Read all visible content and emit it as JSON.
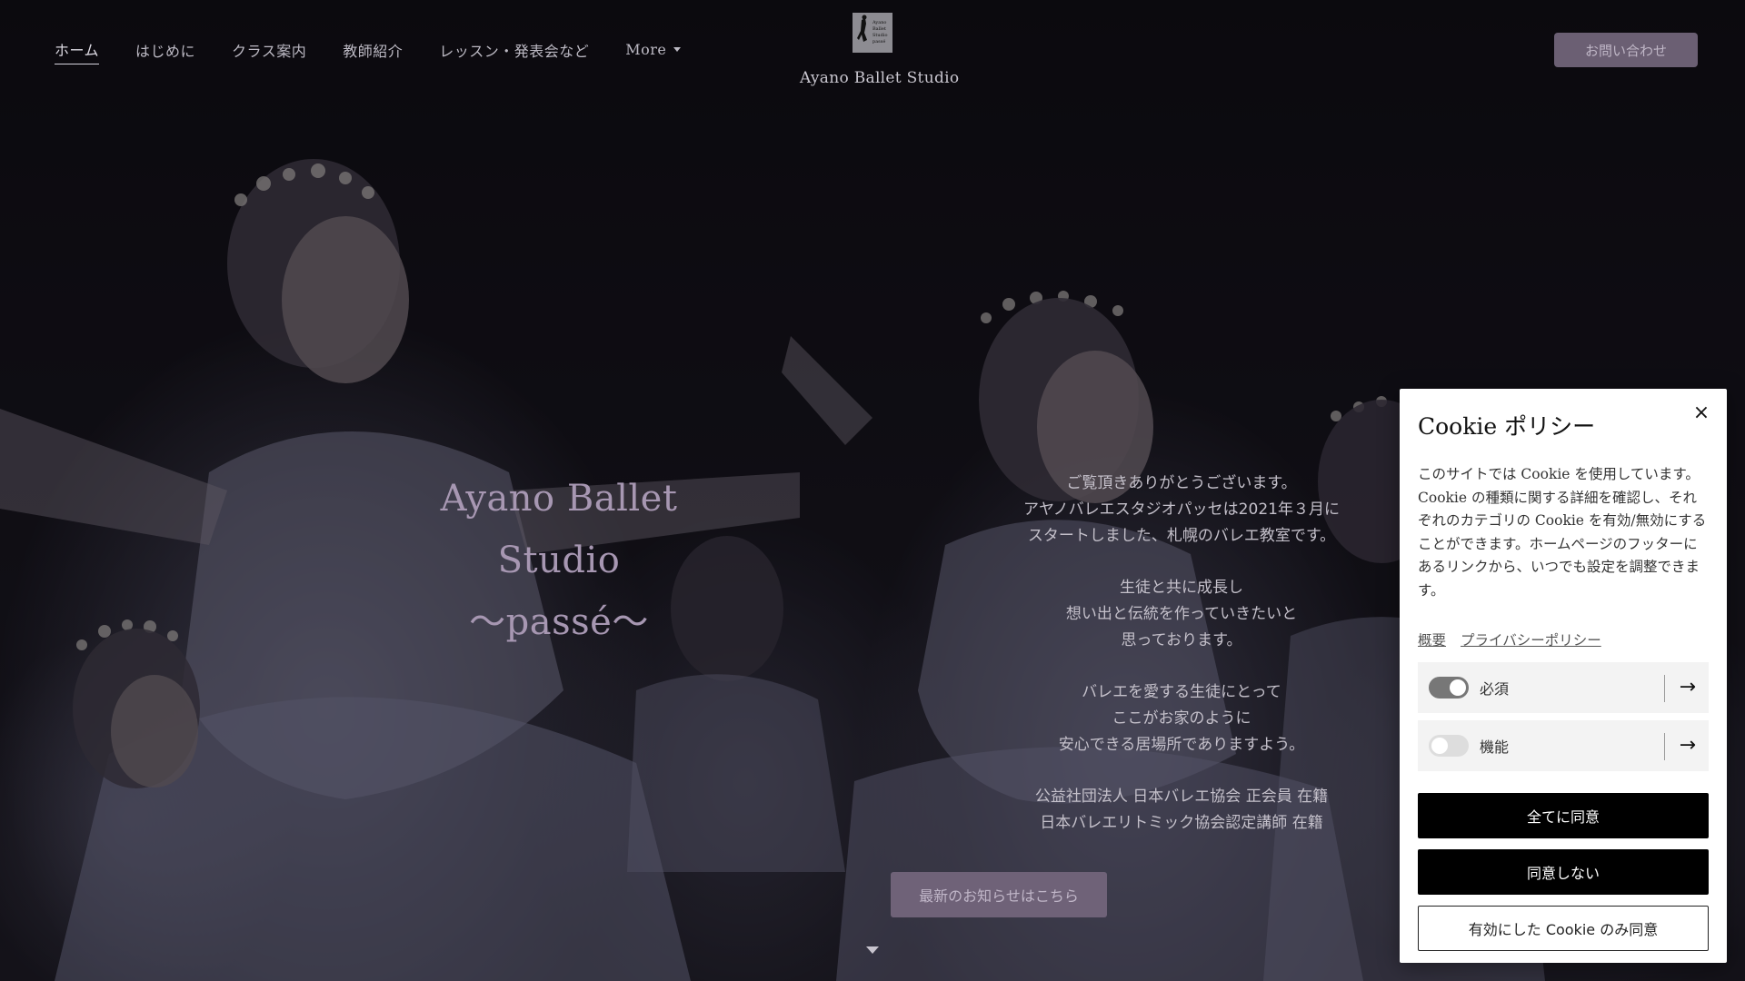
{
  "header": {
    "nav": [
      {
        "label": "ホーム",
        "active": true
      },
      {
        "label": "はじめに"
      },
      {
        "label": "クラス案内"
      },
      {
        "label": "教師紹介"
      },
      {
        "label": "レッスン・発表会など"
      },
      {
        "label": "More"
      }
    ],
    "logo_lines": [
      "Ayano",
      "Ballet",
      "Studio",
      "passé"
    ],
    "site_name": "Ayano Ballet Studio",
    "contact_label": "お問い合わせ"
  },
  "hero": {
    "title_line1": "Ayano Ballet Studio",
    "title_line2": "〜passé〜",
    "paragraphs": [
      [
        "ご覧頂きありがとうございます。",
        "アヤノバレエスタジオパッセは2021年３月に",
        "スタートしました、札幌のバレエ教室です。"
      ],
      [
        "生徒と共に成長し",
        "想い出と伝統を作っていきたいと",
        "思っております。"
      ],
      [
        "バレエを愛する生徒にとって",
        "ここがお家のように",
        "安心できる居場所でありますよう。"
      ],
      [
        "公益社団法人 日本バレエ協会 正会員 在籍",
        "日本バレエリトミック協会認定講師 在籍"
      ]
    ],
    "news_button": "最新のお知らせはこちら"
  },
  "cookie": {
    "title": "Cookie ポリシー",
    "close": "×",
    "description": "このサイトでは Cookie を使用しています。Cookie の種類に関する詳細を確認し、それぞれのカテゴリの Cookie を有効/無効にすることができます。ホームページのフッターにあるリンクから、いつでも設定を調整できます。",
    "links": {
      "overview": "概要",
      "privacy": "プライバシーポリシー"
    },
    "categories": [
      {
        "label": "必須",
        "enabled": true
      },
      {
        "label": "機能",
        "enabled": false
      }
    ],
    "arrow": "→",
    "buttons": {
      "accept_all": "全てに同意",
      "decline": "同意しない",
      "accept_selected": "有効にした Cookie のみ同意"
    }
  }
}
